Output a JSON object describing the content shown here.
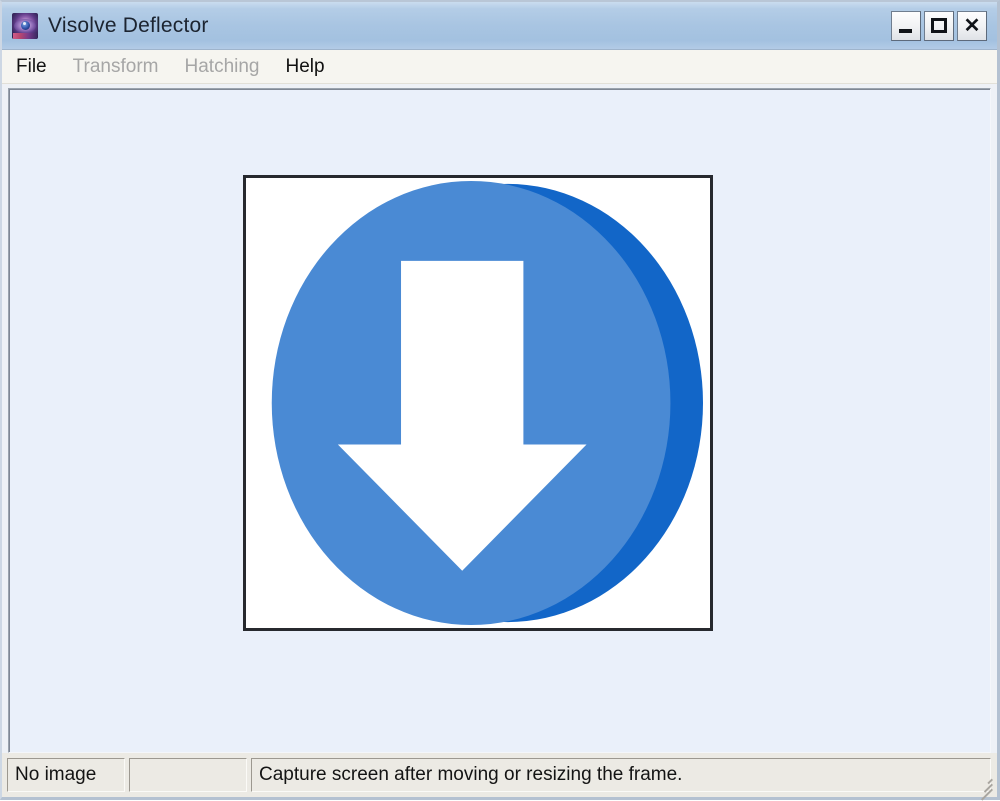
{
  "window": {
    "title": "Visolve Deflector",
    "app_icon": "visolve-eye-icon",
    "controls": {
      "minimize_label": "_",
      "maximize_label": "□",
      "close_label": "✕",
      "minimize_name": "minimize-button",
      "maximize_name": "maximize-button",
      "close_name": "close-button"
    }
  },
  "menu": {
    "items": [
      {
        "label": "File",
        "enabled": true
      },
      {
        "label": "Transform",
        "enabled": false
      },
      {
        "label": "Hatching",
        "enabled": false
      },
      {
        "label": "Help",
        "enabled": true
      }
    ]
  },
  "canvas": {
    "background_color": "#eaf0fa",
    "image": {
      "name": "download-arrow-image",
      "alt": "Blue circle with white downward arrow",
      "frame_border_color": "#27292e",
      "background_color": "#ffffff",
      "circle_light_color": "#4a8ad4",
      "circle_dark_color": "#1266c8",
      "arrow_color": "#ffffff"
    }
  },
  "status_bar": {
    "image_state": "No image",
    "middle_panel": "",
    "message": "Capture screen after moving or resizing the frame.",
    "resize_grip": "resize-grip"
  }
}
